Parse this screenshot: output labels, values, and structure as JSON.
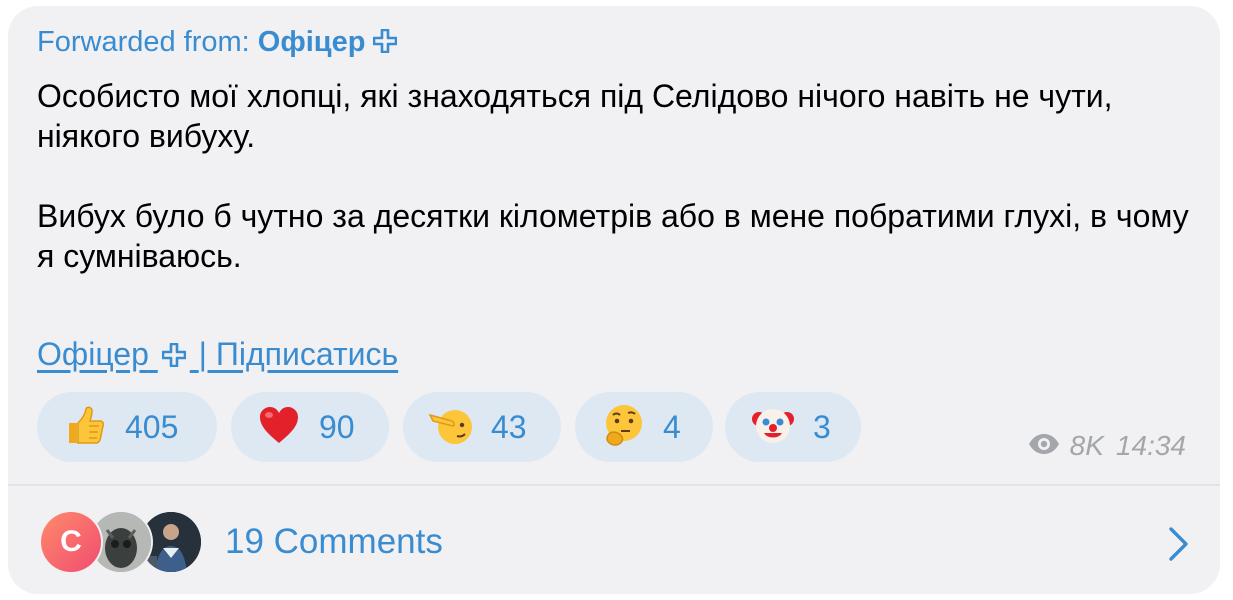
{
  "message": {
    "forward_prefix": "Forwarded from:",
    "forward_source": "Офіцер",
    "paragraphs": [
      "Особисто мої хлопці, які знаходяться під Селідово нічого навіть не чути, ніякого вибуху.",
      "Вибух було б чутно за десятки кілометрів або в мене побратими глухі, в чому я сумніваюсь."
    ],
    "link_source": "Офіцер",
    "link_action": "| Підписатись"
  },
  "reactions": [
    {
      "emoji": "thumbs-up-icon",
      "count": "405"
    },
    {
      "emoji": "red-heart-icon",
      "count": "90"
    },
    {
      "emoji": "saluting-face-icon",
      "count": "43"
    },
    {
      "emoji": "thinking-face-icon",
      "count": "4"
    },
    {
      "emoji": "clown-face-icon",
      "count": "3"
    }
  ],
  "meta": {
    "views": "8K",
    "time": "14:34"
  },
  "comments": {
    "avatar_letter": "C",
    "label": "19 Comments"
  },
  "colors": {
    "accent": "#3a8cd0",
    "bubble_bg": "#f1f1f4",
    "reaction_bg": "#dde8f3",
    "meta": "#a3a6ab"
  }
}
